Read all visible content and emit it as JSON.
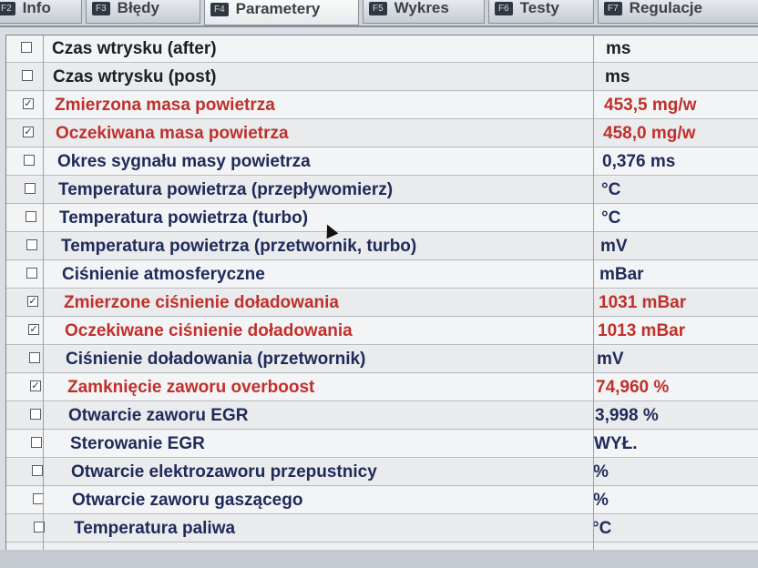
{
  "tabs": [
    {
      "key": "F2",
      "label": "Info"
    },
    {
      "key": "F3",
      "label": "Błędy"
    },
    {
      "key": "F4",
      "label": "Parametery"
    },
    {
      "key": "F5",
      "label": "Wykres"
    },
    {
      "key": "F6",
      "label": "Testy"
    },
    {
      "key": "F7",
      "label": "Regulacje"
    }
  ],
  "active_tab": "Parametery",
  "rows": [
    {
      "name": "Czas wtrysku (after)",
      "value": "ms",
      "checked": false
    },
    {
      "name": "Czas wtrysku (post)",
      "value": "ms",
      "checked": false
    },
    {
      "name": "Zmierzona masa powietrza",
      "value": "453,5 mg/w",
      "checked": true
    },
    {
      "name": "Oczekiwana masa powietrza",
      "value": "458,0 mg/w",
      "checked": true
    },
    {
      "name": "Okres sygnału masy powietrza",
      "value": "0,376 ms",
      "checked": false
    },
    {
      "name": "Temperatura powietrza (przepływomierz)",
      "value": "°C",
      "checked": false
    },
    {
      "name": "Temperatura powietrza (turbo)",
      "value": "°C",
      "checked": false
    },
    {
      "name": "Temperatura powietrza (przetwornik, turbo)",
      "value": "mV",
      "checked": false
    },
    {
      "name": "Ciśnienie atmosferyczne",
      "value": "mBar",
      "checked": false
    },
    {
      "name": "Zmierzone ciśnienie doładowania",
      "value": "1031 mBar",
      "checked": true
    },
    {
      "name": "Oczekiwane ciśnienie doładowania",
      "value": "1013 mBar",
      "checked": true
    },
    {
      "name": "Ciśnienie doładowania (przetwornik)",
      "value": "mV",
      "checked": false
    },
    {
      "name": "Zamknięcie zaworu overboost",
      "value": "74,960 %",
      "checked": true
    },
    {
      "name": "Otwarcie zaworu EGR",
      "value": "3,998 %",
      "checked": false
    },
    {
      "name": "Sterowanie EGR",
      "value": "WYŁ.",
      "checked": false
    },
    {
      "name": "Otwarcie elektrozaworu przepustnicy",
      "value": "%",
      "checked": false
    },
    {
      "name": "Otwarcie zaworu gaszącego",
      "value": "%",
      "checked": false
    },
    {
      "name": "Temperatura paliwa",
      "value": "°C",
      "checked": false
    }
  ],
  "colors": {
    "selected": "#c0302b",
    "normal": "#1e2a5a"
  }
}
